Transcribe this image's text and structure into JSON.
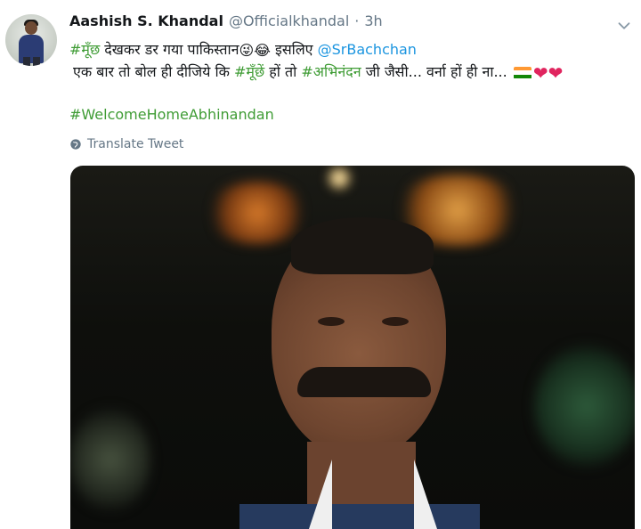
{
  "tweet": {
    "avatar": "avatar",
    "display_name": "Aashish S. Khandal",
    "handle": "@Officialkhandal",
    "separator": "·",
    "time": "3h",
    "caret_icon": "chevron-down-icon",
    "line1": {
      "hashtag": "#मूँछ",
      "text": " देखकर डर गया पाकिस्तान",
      "emoji1": "😜",
      "emoji2": "😂",
      "mid": " इसलिए ",
      "mention": "@SrBachchan"
    },
    "line2": {
      "prefix": "एक बार तो बोल ही दीजिये कि ",
      "hashtag1": "#मूँछें",
      "middle": " हों तो ",
      "hashtag2": "#अभिनंदन",
      "suffix": " जी जैसी... वर्ना हों ही ना... ",
      "heart1": "❤",
      "heart2": "❤"
    },
    "hashtag3": "#WelcomeHomeAbhinandan",
    "translate_label": "Translate Tweet"
  },
  "colors": {
    "link": "#1b95e0",
    "muted": "#657786",
    "text": "#14171a",
    "heart": "#e0245e",
    "flag_saffron": "#ff9933",
    "flag_white": "#ffffff",
    "flag_green": "#138808"
  },
  "media": {
    "alt_subject": "photo",
    "type": "image"
  }
}
